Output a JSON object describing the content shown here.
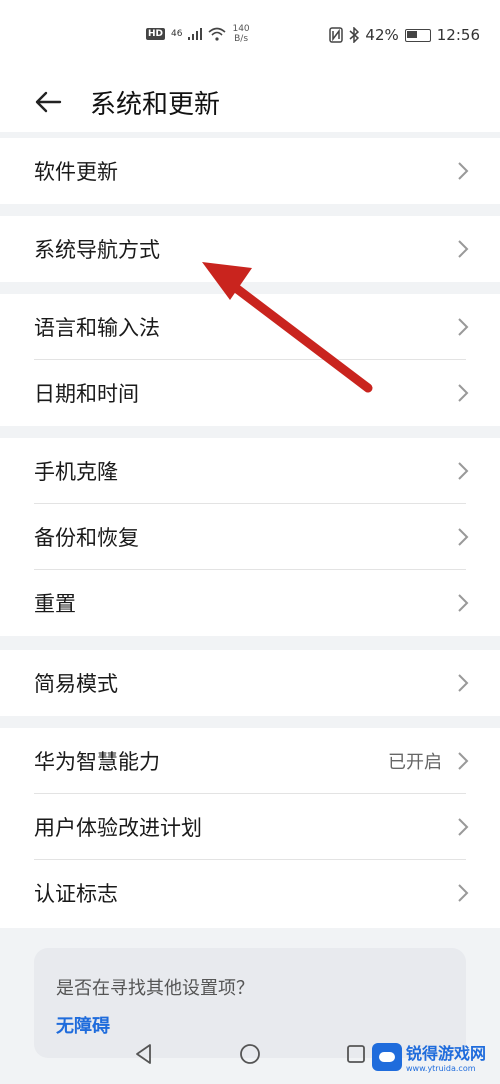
{
  "status_bar": {
    "hd": "HD",
    "network": "46",
    "speed_value": "140",
    "speed_unit": "B/s",
    "battery": "42%",
    "time": "12:56"
  },
  "header": {
    "title": "系统和更新"
  },
  "groups": [
    {
      "items": [
        {
          "label": "软件更新"
        }
      ]
    },
    {
      "items": [
        {
          "label": "系统导航方式"
        }
      ]
    },
    {
      "items": [
        {
          "label": "语言和输入法"
        },
        {
          "label": "日期和时间"
        }
      ]
    },
    {
      "items": [
        {
          "label": "手机克隆"
        },
        {
          "label": "备份和恢复"
        },
        {
          "label": "重置"
        }
      ]
    },
    {
      "items": [
        {
          "label": "简易模式"
        }
      ]
    },
    {
      "items": [
        {
          "label": "华为智慧能力",
          "value": "已开启"
        },
        {
          "label": "用户体验改进计划"
        },
        {
          "label": "认证标志"
        }
      ]
    }
  ],
  "suggest": {
    "title": "是否在寻找其他设置项？",
    "link": "无障碍"
  },
  "watermark": {
    "main": "锐得游戏网",
    "sub": "www.ytruida.com"
  },
  "colors": {
    "accent": "#1f6cdc",
    "annotation_arrow": "#c9241e"
  },
  "icons": [
    "back-arrow-icon",
    "chevron-right-icon",
    "nav-back-icon",
    "nav-home-icon",
    "nav-recent-icon"
  ]
}
